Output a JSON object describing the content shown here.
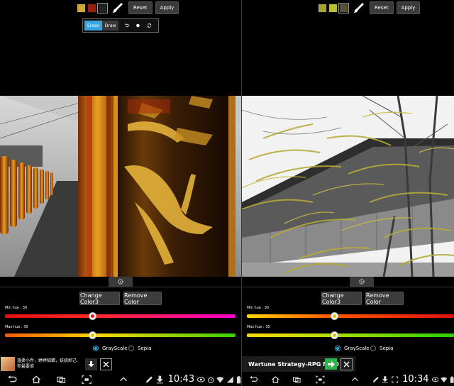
{
  "colors": {
    "accent": "#3aa6e0",
    "hue_red": "#d81a1a",
    "hue_yellow": "#e3c300"
  },
  "left": {
    "toolbar": {
      "swatches": [
        "#d4a830",
        "#9a1e10",
        "#222222"
      ],
      "reset_label": "Reset",
      "apply_label": "Apply"
    },
    "popup": {
      "erase_label": "Erase",
      "draw_label": "Draw"
    },
    "change_color_label": "Change Color3",
    "remove_color_label": "Remove Color",
    "min_hue_label": "Min hue : 30",
    "max_hue_label": "Max hue : 30",
    "min_hue_value": 30,
    "max_hue_value": 30,
    "grayscale_label": "GrayScale",
    "sepia_label": "Sepia",
    "selected_mode": "GrayScale",
    "ad_text": "溫柔小乔，婷婷貂蝉，妖娆妲己 你最要谁",
    "time": "10:43"
  },
  "right": {
    "toolbar": {
      "swatches": [
        "#a8a038",
        "#b8c03a",
        "#5a5230"
      ],
      "reset_label": "Reset",
      "apply_label": "Apply"
    },
    "change_color_label": "Change Color3",
    "remove_color_label": "Remove Color",
    "min_hue_label": "Min hue : 30",
    "max_hue_label": "Max hue : 30",
    "min_hue_value": 30,
    "max_hue_value": 30,
    "grayscale_label": "GrayScale",
    "sepia_label": "Sepia",
    "selected_mode": "GrayScale",
    "ad_text": "Wartune Strategy-RPG MMO",
    "time": "10:34"
  }
}
